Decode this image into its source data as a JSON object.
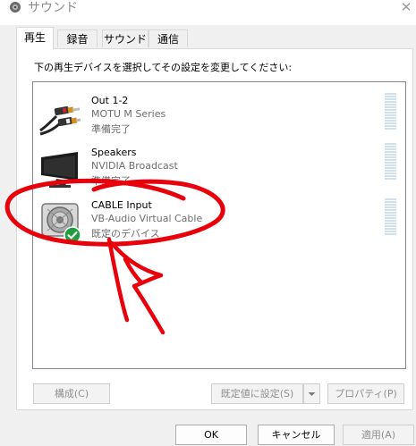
{
  "window": {
    "title": "サウンド",
    "close_glyph": "✕"
  },
  "tabs": [
    {
      "label": "再生"
    },
    {
      "label": "録音"
    },
    {
      "label": "サウンド"
    },
    {
      "label": "通信"
    }
  ],
  "instruction": "下の再生デバイスを選択してその設定を変更してください:",
  "devices": [
    {
      "name": "Out 1-2",
      "description": "MOTU M Series",
      "status": "準備完了",
      "icon": "rca-cable-icon",
      "default": false
    },
    {
      "name": "Speakers",
      "description": "NVIDIA Broadcast",
      "status": "準備完了",
      "icon": "monitor-icon",
      "default": false
    },
    {
      "name": "CABLE Input",
      "description": "VB-Audio Virtual Cable",
      "status": "既定のデバイス",
      "icon": "speaker-icon",
      "default": true
    }
  ],
  "buttons": {
    "configure": "構成(C)",
    "set_default": "既定値に設定(S)",
    "properties": "プロパティ(P)",
    "ok": "OK",
    "cancel": "キャンセル",
    "apply": "適用(A)"
  },
  "colors": {
    "annotation": "#e8000b",
    "default_check": "#1e9e3c",
    "meter": "#cfe0ee"
  }
}
